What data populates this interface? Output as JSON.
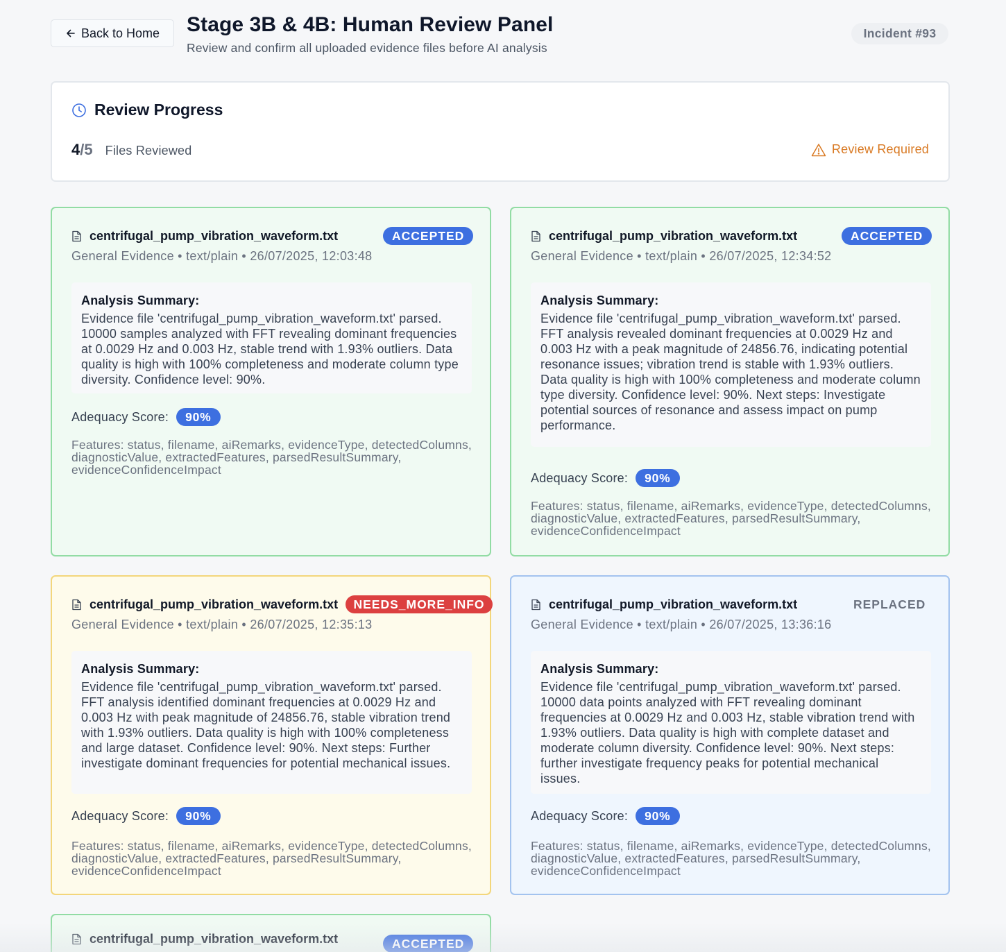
{
  "header": {
    "back_label": "Back to Home",
    "title": "Stage 3B & 4B: Human Review Panel",
    "subtitle": "Review and confirm all uploaded evidence files before AI analysis",
    "incident": "Incident #93"
  },
  "progress": {
    "title": "Review Progress",
    "reviewed": "4",
    "slash": "/",
    "total": "5",
    "label": "Files Reviewed",
    "status": "Review Required"
  },
  "cards": [
    {
      "filename": "centrifugal_pump_vibration_waveform.txt",
      "status": "ACCEPTED",
      "meta": "General Evidence • text/plain • 26/07/2025, 12:03:48",
      "summary_heading": "Analysis Summary:",
      "summary": "Evidence file 'centrifugal_pump_vibration_waveform.txt' parsed. 10000 samples analyzed with FFT revealing dominant frequencies at 0.0029 Hz and 0.003 Hz, stable trend with 1.93% outliers. Data quality is high with 100% completeness and moderate column type diversity. Confidence level: 90%.",
      "adequacy_label": "Adequacy Score:",
      "adequacy": "90%",
      "features": "Features: status, filename, aiRemarks, evidenceType, detectedColumns, diagnosticValue, extractedFeatures, parsedResultSummary, evidenceConfidenceImpact"
    },
    {
      "filename": "centrifugal_pump_vibration_waveform.txt",
      "status": "ACCEPTED",
      "meta": "General Evidence • text/plain • 26/07/2025, 12:34:52",
      "summary_heading": "Analysis Summary:",
      "summary": "Evidence file 'centrifugal_pump_vibration_waveform.txt' parsed. FFT analysis revealed dominant frequencies at 0.0029 Hz and 0.003 Hz with a peak magnitude of 24856.76, indicating potential resonance issues; vibration trend is stable with 1.93% outliers. Data quality is high with 100% completeness and moderate column type diversity. Confidence level: 90%. Next steps: Investigate potential sources of resonance and assess impact on pump performance.",
      "adequacy_label": "Adequacy Score:",
      "adequacy": "90%",
      "features": "Features: status, filename, aiRemarks, evidenceType, detectedColumns, diagnosticValue, extractedFeatures, parsedResultSummary, evidenceConfidenceImpact"
    },
    {
      "filename": "centrifugal_pump_vibration_waveform.txt",
      "status": "NEEDS_MORE_INFO",
      "meta": "General Evidence • text/plain • 26/07/2025, 12:35:13",
      "summary_heading": "Analysis Summary:",
      "summary": "Evidence file 'centrifugal_pump_vibration_waveform.txt' parsed. FFT analysis identified dominant frequencies at 0.0029 Hz and 0.003 Hz with peak magnitude of 24856.76, stable vibration trend with 1.93% outliers. Data quality is high with 100% completeness and large dataset. Confidence level: 90%. Next steps: Further investigate dominant frequencies for potential mechanical issues.",
      "adequacy_label": "Adequacy Score:",
      "adequacy": "90%",
      "features": "Features: status, filename, aiRemarks, evidenceType, detectedColumns, diagnosticValue, extractedFeatures, parsedResultSummary, evidenceConfidenceImpact"
    },
    {
      "filename": "centrifugal_pump_vibration_waveform.txt",
      "status": "REPLACED",
      "meta": "General Evidence • text/plain • 26/07/2025, 13:36:16",
      "summary_heading": "Analysis Summary:",
      "summary": "Evidence file 'centrifugal_pump_vibration_waveform.txt' parsed. 10000 data points analyzed with FFT revealing dominant frequencies at 0.0029 Hz and 0.003 Hz, stable vibration trend with 1.93% outliers. Data quality is high with complete dataset and moderate column diversity. Confidence level: 90%. Next steps: further investigate frequency peaks for potential mechanical issues.",
      "adequacy_label": "Adequacy Score:",
      "adequacy": "90%",
      "features": "Features: status, filename, aiRemarks, evidenceType, detectedColumns, diagnosticValue, extractedFeatures, parsedResultSummary, evidenceConfidenceImpact"
    },
    {
      "filename": "centrifugal_pump_vibration_waveform.txt",
      "status": "ACCEPTED"
    }
  ],
  "colors": {
    "accepted_border": "#92dca4",
    "accepted_bg": "#f0faf3",
    "needs_border": "#f3d67b",
    "needs_bg": "#fefbeb",
    "replaced_border": "#a3c3ef",
    "replaced_bg": "#eff6fe",
    "badge_blue": "#3d6fe0",
    "badge_red": "#dc4040",
    "warning": "#d97a24"
  },
  "icons": {
    "back": "arrow-left-icon",
    "progress": "clock-icon",
    "warning": "warning-triangle-icon",
    "file": "file-text-icon"
  }
}
